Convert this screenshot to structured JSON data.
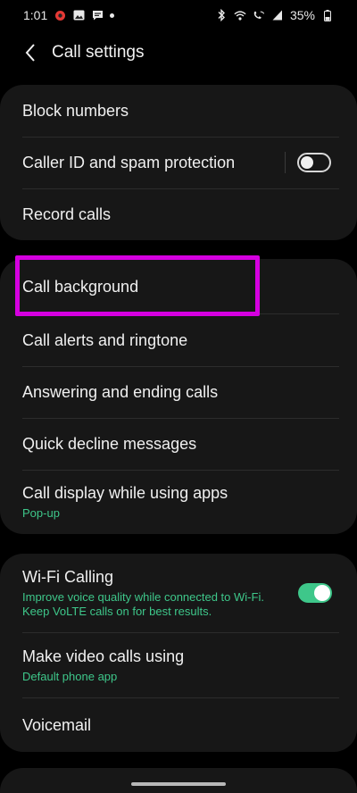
{
  "status_bar": {
    "time": "1:01",
    "battery": "35%",
    "left_icons": [
      "app-notification-icon",
      "image-icon",
      "message-icon",
      "dot-icon"
    ],
    "right_icons": [
      "bluetooth-icon",
      "wifi-icon",
      "wifi-calling-icon",
      "signal-icon",
      "battery-icon"
    ]
  },
  "header": {
    "title": "Call settings",
    "back_icon": "chevron-left-icon"
  },
  "group1": {
    "items": [
      {
        "label": "Block numbers"
      },
      {
        "label": "Caller ID and spam protection",
        "toggle": "off"
      },
      {
        "label": "Record calls"
      }
    ]
  },
  "group2": {
    "items": [
      {
        "label": "Call background"
      },
      {
        "label": "Call alerts and ringtone"
      },
      {
        "label": "Answering and ending calls"
      },
      {
        "label": "Quick decline messages"
      },
      {
        "label": "Call display while using apps",
        "sub": "Pop-up"
      }
    ]
  },
  "group3": {
    "items": [
      {
        "label": "Wi-Fi Calling",
        "sub_line1": "Improve voice quality while connected to Wi-Fi.",
        "sub_line2": "Keep VoLTE calls on for best results.",
        "toggle": "on"
      },
      {
        "label": "Make video calls using",
        "sub": "Default phone app"
      },
      {
        "label": "Voicemail"
      }
    ]
  },
  "colors": {
    "background": "#000000",
    "card": "#171717",
    "accent_green": "#3ec78a",
    "highlight": "#d500e0"
  }
}
